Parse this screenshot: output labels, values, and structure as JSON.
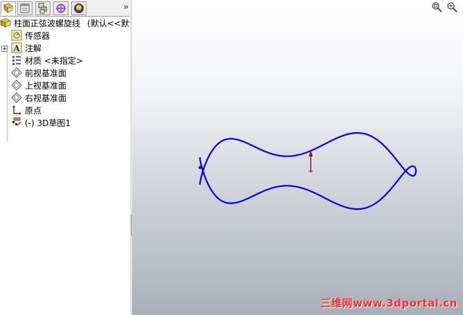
{
  "feature_manager": {
    "tabs": [
      {
        "name": "feature-manager-tab",
        "icon": "feature-tree-icon"
      },
      {
        "name": "property-manager-tab",
        "icon": "property-icon"
      },
      {
        "name": "configuration-manager-tab",
        "icon": "configuration-icon"
      },
      {
        "name": "dimxpert-manager-tab",
        "icon": "crosshair-icon"
      },
      {
        "name": "display-manager-tab",
        "icon": "appearance-icon"
      }
    ],
    "more_label": "»",
    "root": {
      "label": "柱面正弦波螺旋线",
      "config": "(默认<<默认"
    },
    "items": [
      {
        "label": "传感器",
        "icon": "sensor-icon"
      },
      {
        "label": "注解",
        "icon": "annotation-icon",
        "expand": "+"
      },
      {
        "label": "材质 <未指定>",
        "icon": "material-icon"
      },
      {
        "label": "前视基准面",
        "icon": "plane-icon"
      },
      {
        "label": "上视基准面",
        "icon": "plane-icon"
      },
      {
        "label": "右视基准面",
        "icon": "plane-icon"
      },
      {
        "label": "原点",
        "icon": "origin-icon"
      },
      {
        "label": "(-) 3D草图1",
        "icon": "sketch-3d-icon"
      }
    ]
  },
  "viewport": {
    "tools": [
      "zoom-to-fit-icon",
      "zoom-to-area-icon"
    ],
    "curve_color": "#0000ee",
    "watermark": "三维网www.3dportal.cn"
  }
}
